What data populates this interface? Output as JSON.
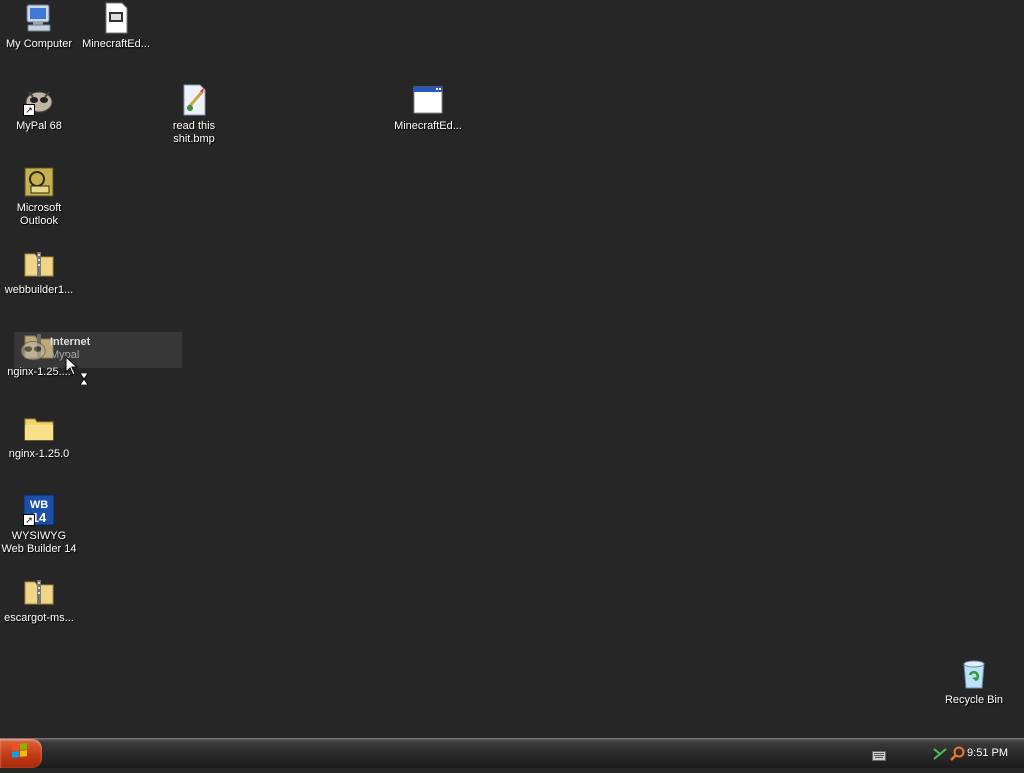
{
  "desktop": {
    "icons": [
      {
        "label": "My Computer",
        "icon": "my-computer-icon"
      },
      {
        "label": "MinecraftEd...",
        "icon": "document-icon"
      },
      {
        "label": "MyPal 68",
        "icon": "mypal-icon"
      },
      {
        "label": "read this shit.bmp",
        "icon": "bitmap-image-icon"
      },
      {
        "label": "MinecraftEd...",
        "icon": "application-window-icon"
      },
      {
        "label": "Microsoft Outlook",
        "icon": "outlook-icon"
      },
      {
        "label": "webbuilder1...",
        "icon": "zip-folder-icon"
      },
      {
        "label": "nginx-1.25....",
        "icon": "zip-folder-icon"
      },
      {
        "label": "nginx-1.25.0",
        "icon": "folder-icon"
      },
      {
        "label": "WYSIWYG Web Builder 14",
        "icon": "webbuilder-icon"
      },
      {
        "label": "escargot-ms...",
        "icon": "zip-folder-icon"
      },
      {
        "label": "Recycle Bin",
        "icon": "recycle-bin-icon"
      }
    ],
    "drag_ghost": {
      "title": "Internet",
      "subtitle": "Mypal"
    }
  },
  "taskbar": {
    "clock": "9:51 PM",
    "tray_icons": [
      "keyboard-icon",
      "network-icon",
      "search-icon"
    ]
  },
  "colors": {
    "desktop_background": "#262626",
    "start_button": "#c23a16",
    "label_text": "#ffffff"
  }
}
